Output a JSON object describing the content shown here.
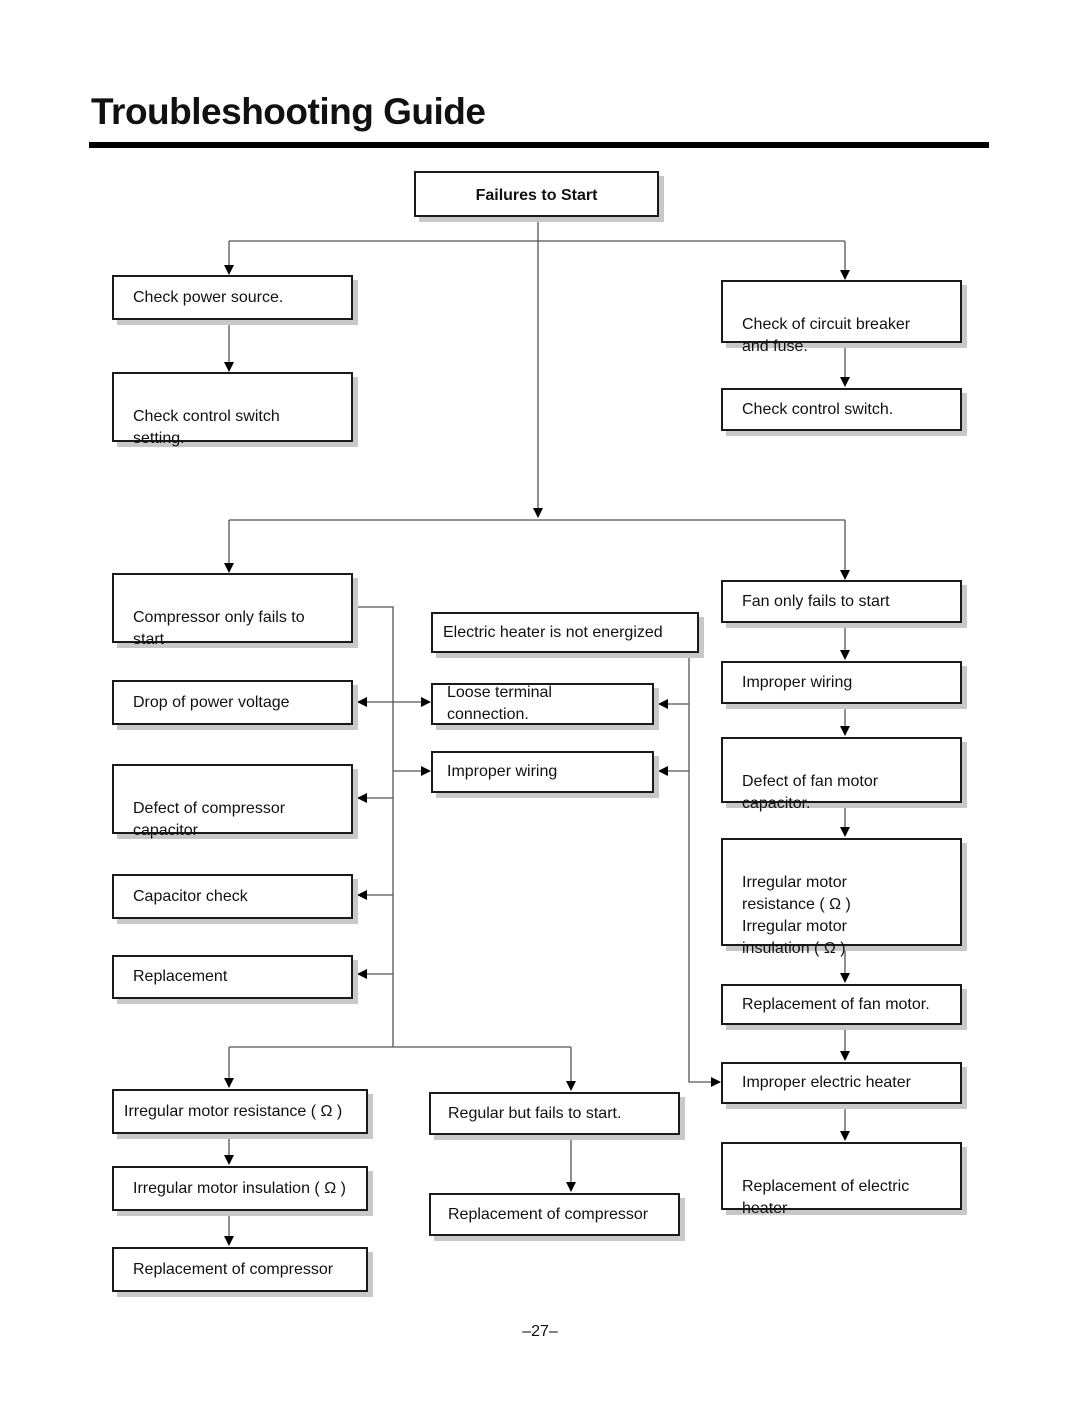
{
  "page": {
    "title": "Troubleshooting Guide",
    "page_number": "–27–"
  },
  "flowchart": {
    "root": {
      "id": "failures-to-start",
      "label": "Failures to Start"
    },
    "nodes": {
      "check_power_source": "Check power source.",
      "check_control_switch_setting": "Check control switch\nsetting.",
      "check_circuit_breaker": "Check of circuit breaker\nand fuse.",
      "check_control_switch": "Check control switch.",
      "compressor_only_fails": "Compressor only fails to\n start",
      "electric_heater_not_energized": "Electric heater is not energized",
      "fan_only_fails": "Fan only fails to start",
      "drop_power_voltage": "Drop of power voltage",
      "loose_terminal": "Loose terminal connection.",
      "improper_wiring_center": "Improper wiring",
      "improper_wiring_fan": "Improper wiring",
      "defect_compressor_capacitor": "Defect of compressor\ncapacitor",
      "defect_fan_capacitor": "Defect of fan motor\ncapacitor.",
      "capacitor_check": "Capacitor check",
      "irregular_fan_motor": "Irregular motor\nresistance  ( Ω )\nIrregular motor\ninsulation  ( Ω )",
      "replacement": "Replacement",
      "replacement_fan_motor": "Replacement of fan motor.",
      "irregular_motor_resistance": "Irregular motor resistance ( Ω )",
      "regular_but_fails": "Regular but fails to start.",
      "improper_electric_heater": "Improper electric heater",
      "irregular_motor_insulation": "Irregular motor insulation ( Ω )",
      "replacement_compressor_center": "Replacement of compressor",
      "replacement_electric_heater": "Replacement of electric\nheater",
      "replacement_compressor_left": "Replacement of compressor"
    }
  }
}
